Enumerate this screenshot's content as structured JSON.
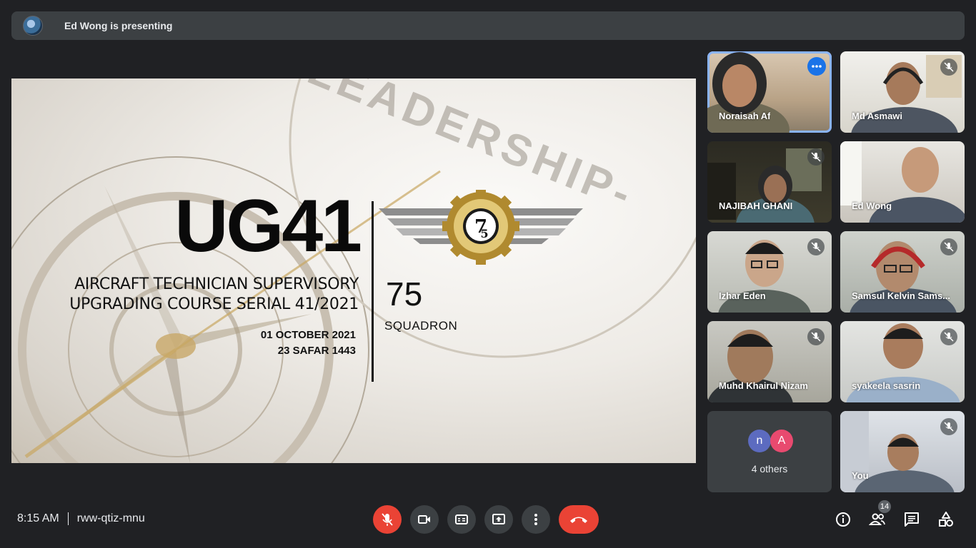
{
  "banner": {
    "text": "Ed Wong is presenting"
  },
  "slide": {
    "title": "UG41",
    "course_line1": "AIRCRAFT TECHNICIAN SUPERVISORY",
    "course_line2": "UPGRADING COURSE SERIAL 41/2021",
    "date_line1": "01 OCTOBER 2021",
    "date_line2": "23 SAFAR 1443",
    "squadron_number": "75",
    "squadron_label": "SQUADRON",
    "background_word": "-LEADERSHIP-"
  },
  "participants": [
    {
      "name": "Noraisah Af",
      "muted": false,
      "active": true
    },
    {
      "name": "Md Asmawi",
      "muted": true
    },
    {
      "name": "NAJIBAH GHANI",
      "muted": true
    },
    {
      "name": "Ed Wong",
      "muted": false
    },
    {
      "name": "Izhar Eden",
      "muted": true
    },
    {
      "name": "Samsul Kelvin Sams...",
      "muted": true
    },
    {
      "name": "Muhd Khairul Nizam",
      "muted": true
    },
    {
      "name": "syakeela sasrin",
      "muted": true
    },
    {
      "name": "You",
      "muted": true
    }
  ],
  "others": {
    "label": "4 others",
    "avatars": [
      "n",
      "A"
    ],
    "avatar_colors": [
      "#5c6bc0",
      "#e84a6f"
    ]
  },
  "footer": {
    "time": "8:15 AM",
    "meeting_code": "rww-qtiz-mnu",
    "people_count": "14"
  },
  "icons": [
    "mic-off-icon",
    "camera-icon",
    "captions-icon",
    "present-icon",
    "more-options-icon",
    "hangup-icon",
    "info-icon",
    "people-icon",
    "chat-icon",
    "activities-icon"
  ],
  "colors": {
    "background": "#202124",
    "surface": "#3c4043",
    "danger": "#ea4335",
    "accent": "#8ab4f8"
  }
}
